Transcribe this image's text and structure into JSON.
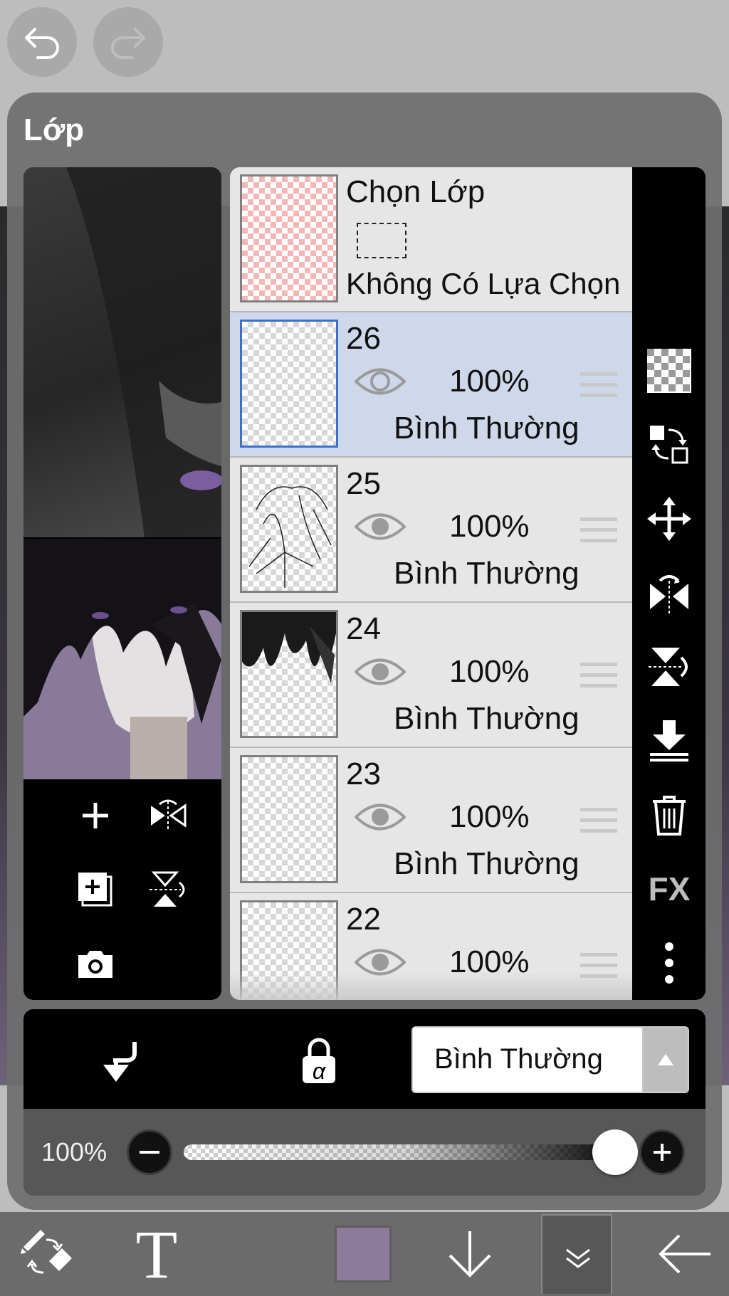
{
  "colors": {
    "accent_selected_row": "#cfd8ea",
    "selected_border": "#3b6fd0",
    "current_color": "#8c7b9a"
  },
  "top": {
    "undo_icon": "undo-arrow-icon",
    "redo_icon": "redo-arrow-icon"
  },
  "panel": {
    "title": "Lớp"
  },
  "selection_layer": {
    "title": "Chọn Lớp",
    "subtitle": "Không Có Lựa Chọn"
  },
  "layers": [
    {
      "name": "26",
      "opacity": "100%",
      "blend": "Bình Thường",
      "selected": true
    },
    {
      "name": "25",
      "opacity": "100%",
      "blend": "Bình Thường",
      "selected": false
    },
    {
      "name": "24",
      "opacity": "100%",
      "blend": "Bình Thường",
      "selected": false
    },
    {
      "name": "23",
      "opacity": "100%",
      "blend": "Bình Thường",
      "selected": false
    },
    {
      "name": "22",
      "opacity": "100%",
      "blend": "",
      "selected": false
    }
  ],
  "right_toolbar": {
    "fx_label": "FX"
  },
  "action_row": {
    "blend_mode": "Bình Thường",
    "alpha_lock_glyph": "α"
  },
  "opacity": {
    "label": "100%",
    "value": 1.0
  },
  "bottom_toolbar": {
    "text_tool_glyph": "T"
  }
}
